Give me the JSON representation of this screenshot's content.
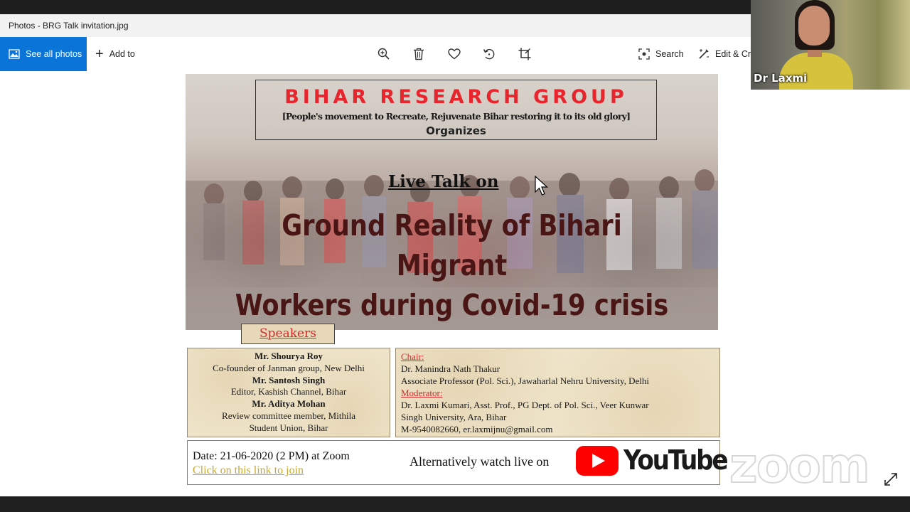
{
  "window": {
    "title": "Photos - BRG Talk invitation.jpg"
  },
  "toolbar": {
    "see_all_photos": "See all photos",
    "add_to": "Add to",
    "icons": [
      "zoom-icon",
      "delete-icon",
      "favorite-icon",
      "rotate-icon",
      "crop-icon"
    ],
    "search": "Search",
    "edit_create": "Edit & Cre"
  },
  "poster": {
    "org_title": "BIHAR RESEARCH GROUP",
    "org_tagline": "[People's movement to Recreate, Rejuvenate Bihar restoring it to its old glory]",
    "organizes": "Organizes",
    "live_talk": "Live Talk on",
    "headline_line1": "Ground Reality of Bihari Migrant",
    "headline_line2": "Workers during Covid-19 crisis",
    "speakers_label": "Speakers",
    "speakers": [
      {
        "name": "Mr. Shourya Roy",
        "role": "Co-founder  of Janman group, New Delhi"
      },
      {
        "name": "Mr. Santosh Singh",
        "role": "Editor, Kashish Channel, Bihar"
      },
      {
        "name": "Mr. Aditya Mohan",
        "role": "Review committee member, Mithila",
        "role2": "Student Union, Bihar"
      }
    ],
    "chair_label": "Chair:",
    "chair_name": "Dr. Manindra Nath Thakur",
    "chair_role": "Associate Professor  (Pol. Sci.), Jawaharlal Nehru University, Delhi",
    "moderator_label": "Moderator:",
    "moderator_line1": "Dr. Laxmi Kumari, Asst. Prof., PG Dept. of Pol. Sci., Veer Kunwar",
    "moderator_line2": "Singh University, Ara, Bihar",
    "moderator_contact": "M-9540082660, er.laxmijnu@gmail.com",
    "date": "Date: 21-06-2020  (2 PM)  at Zoom",
    "join_link": "Click on this link to join",
    "alt_watch": "Alternatively watch live on",
    "youtube": "YouTube"
  },
  "zoom": {
    "participant_name": "Dr Laxmi",
    "watermark": "zoom"
  },
  "colors": {
    "accent": "#0a74d8",
    "brg_red": "#e8242c",
    "headline": "#4a1515",
    "link_gold": "#c8a830",
    "youtube_red": "#ff0000"
  }
}
